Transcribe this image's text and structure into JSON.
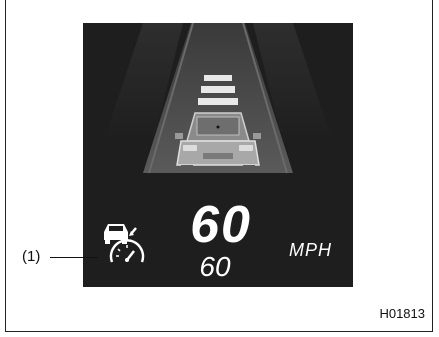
{
  "display": {
    "set_speed": "60",
    "current_speed": "60",
    "unit": "MPH"
  },
  "callout": {
    "label": "(1)"
  },
  "figure_code": "H01813",
  "icons": {
    "acc": "adaptive-cruise-control-icon",
    "vehicle": "lead-vehicle-icon"
  },
  "colors": {
    "panel_bg": "#1e1e1e",
    "road": "#4a4a4a",
    "text": "#ffffff"
  }
}
